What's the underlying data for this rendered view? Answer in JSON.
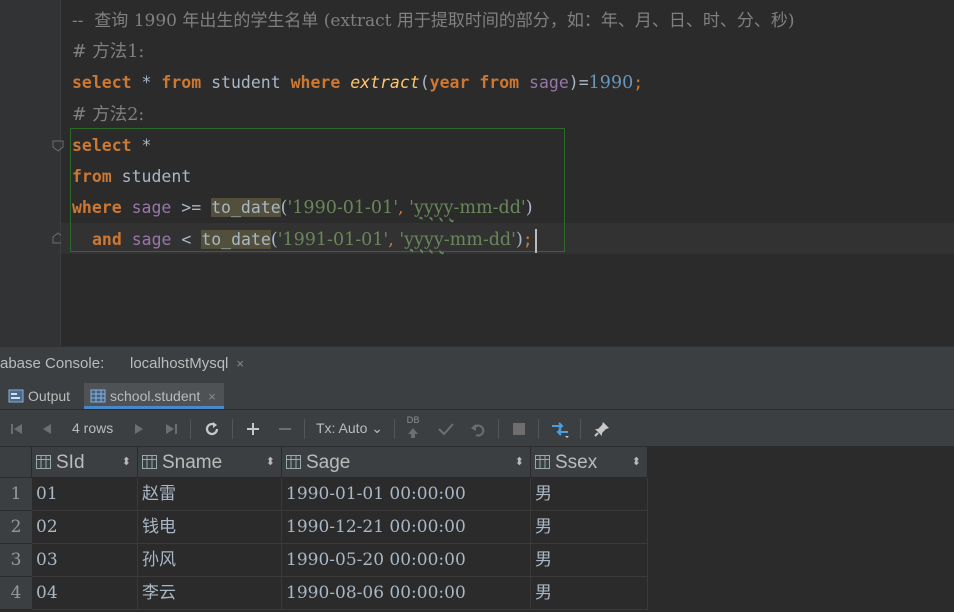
{
  "editor": {
    "comment_line": "--  查询 1990 年出生的学生名单 (extract 用于提取时间的部分，如：年、月、日、时、分、秒)",
    "method1_comment": "# 方法1:",
    "line3": {
      "kw_select": "select",
      "star": " * ",
      "kw_from": "from",
      "table": " student ",
      "kw_where": "where",
      "sp": " ",
      "fn_extract": "extract",
      "paren_open": "(",
      "kw_year": "year",
      "kw_from2": "from",
      "col_sage": "sage",
      "paren_close_eq": ")=",
      "num_1990": "1990",
      "semi": ";"
    },
    "method2_comment": "# 方法2:",
    "line5": {
      "kw_select": "select",
      "star": " *"
    },
    "line6": {
      "kw_from": "from",
      "table": " student"
    },
    "line7": {
      "kw_where": "where",
      "col_sage": "sage",
      "op": " >= ",
      "fn": "to_date",
      "p1": "(",
      "str1": "'1990-01-01'",
      "comma": ", ",
      "str2_q1": "'",
      "str2_fmt": "yyyy",
      "str2_rest": "-mm-dd'",
      "p2": ")"
    },
    "line8": {
      "kw_and": "and",
      "col_sage": "sage",
      "op": " < ",
      "fn": "to_date",
      "p1": "(",
      "str1": "'1991-01-01'",
      "comma": ", ",
      "str2_q1": "'",
      "str2_fmt": "yyyy",
      "str2_rest": "-mm-dd'",
      "p2": ")",
      "semi": ";"
    }
  },
  "console": {
    "tab1_label": "abase Console:",
    "tab2_label": "localhostMysql",
    "close_glyph": "×",
    "subtab_output": "Output",
    "subtab_table": "school.student",
    "toolbar": {
      "rows_label": "4 rows",
      "tx_label": "Tx: Auto",
      "tx_arrow": "⌄",
      "db_label": "DB"
    }
  },
  "grid": {
    "columns": [
      "SId",
      "Sname",
      "Sage",
      "Ssex"
    ],
    "sort_glyph": "⬍",
    "rows": [
      {
        "num": "1",
        "SId": "01",
        "Sname": "赵雷",
        "Sage": "1990-01-01 00:00:00",
        "Ssex": "男"
      },
      {
        "num": "2",
        "SId": "02",
        "Sname": "钱电",
        "Sage": "1990-12-21 00:00:00",
        "Ssex": "男"
      },
      {
        "num": "3",
        "SId": "03",
        "Sname": "孙风",
        "Sage": "1990-05-20 00:00:00",
        "Ssex": "男"
      },
      {
        "num": "4",
        "SId": "04",
        "Sname": "李云",
        "Sage": "1990-08-06 00:00:00",
        "Ssex": "男"
      }
    ]
  },
  "colors": {
    "keyword": "#cc7832",
    "string": "#6a8759",
    "number": "#6897bb",
    "column": "#9876aa",
    "function": "#ffc66d",
    "comment": "#808080"
  }
}
